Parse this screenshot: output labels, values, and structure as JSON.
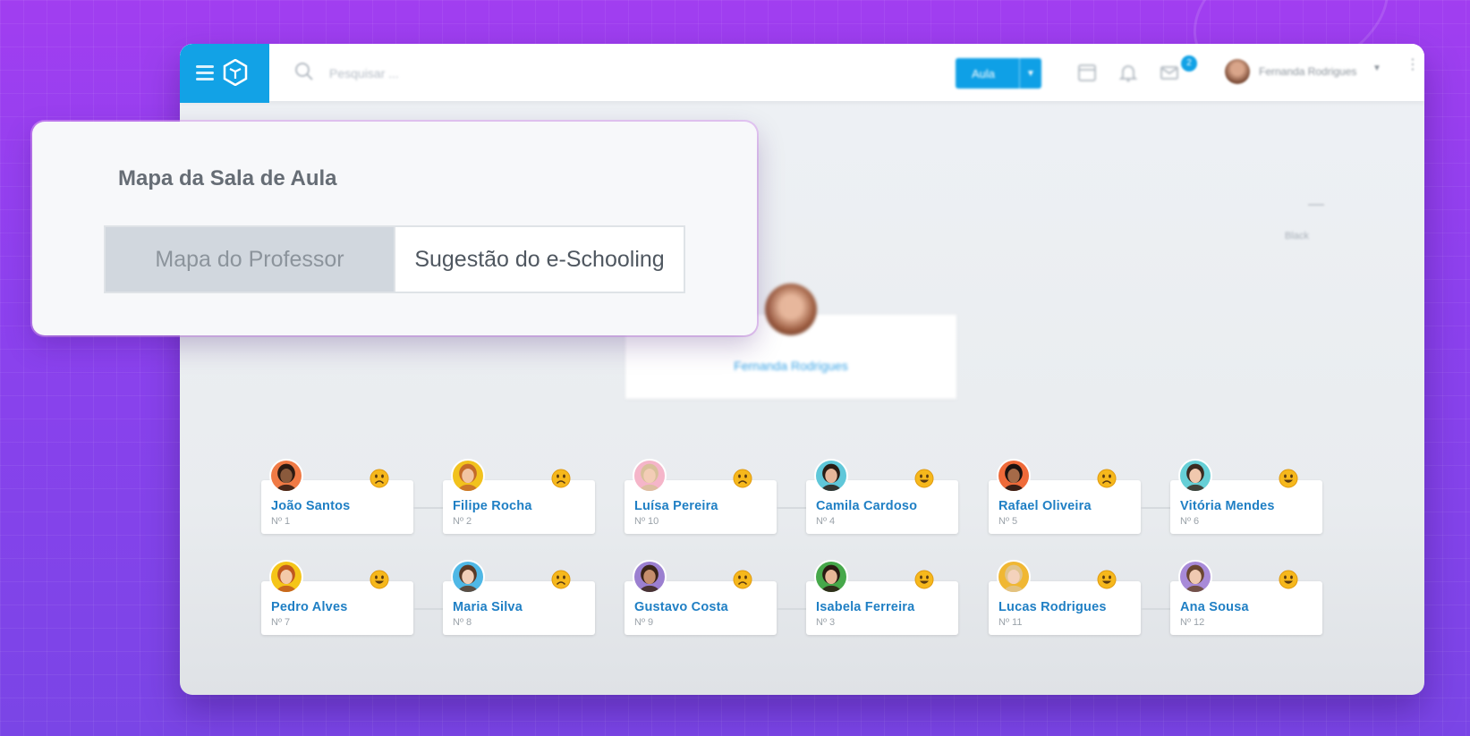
{
  "header": {
    "search_placeholder": "Pesquisar ...",
    "class_button_label": "Aula",
    "messages_badge": "2",
    "user_name": "Fernanda Rodrigues"
  },
  "theme": {
    "dark_mode_label": "Black"
  },
  "teacher": {
    "name": "Fernanda Rodrigues"
  },
  "panel": {
    "title": "Mapa da Sala de Aula",
    "tabs": [
      {
        "label": "Mapa do Professor",
        "active": false
      },
      {
        "label": "Sugestão do e-Schooling",
        "active": true
      }
    ]
  },
  "students": [
    {
      "name": "João Santos",
      "number": "Nº 1",
      "mood": "sad",
      "hair": "#2b1a12",
      "skin": "#8a5a3c",
      "bg": "#f07a45"
    },
    {
      "name": "Filipe Rocha",
      "number": "Nº 2",
      "mood": "sad",
      "hair": "#c46a2a",
      "skin": "#f1c4a2",
      "bg": "#f2c21d"
    },
    {
      "name": "Luísa Pereira",
      "number": "Nº 10",
      "mood": "sad",
      "hair": "#d8c09a",
      "skin": "#f3cdb6",
      "bg": "#f5b5c9"
    },
    {
      "name": "Camila Cardoso",
      "number": "Nº 4",
      "mood": "happy",
      "hair": "#2a1c14",
      "skin": "#e6b69a",
      "bg": "#5fc7d9"
    },
    {
      "name": "Rafael Oliveira",
      "number": "Nº 5",
      "mood": "sad",
      "hair": "#1a1210",
      "skin": "#a56a48",
      "bg": "#ef6a39"
    },
    {
      "name": "Vitória Mendes",
      "number": "Nº 6",
      "mood": "happy",
      "hair": "#3b2a20",
      "skin": "#f0c8ae",
      "bg": "#66cfd6"
    },
    {
      "name": "Pedro Alves",
      "number": "Nº 7",
      "mood": "happy",
      "hair": "#c0571f",
      "skin": "#f3c9a9",
      "bg": "#f5c518"
    },
    {
      "name": "Maria Silva",
      "number": "Nº 8",
      "mood": "sad",
      "hair": "#5b3a26",
      "skin": "#f2cfb8",
      "bg": "#4fb8e6"
    },
    {
      "name": "Gustavo Costa",
      "number": "Nº 9",
      "mood": "sad",
      "hair": "#3a2418",
      "skin": "#c58e6c",
      "bg": "#9b7fd0"
    },
    {
      "name": "Isabela Ferreira",
      "number": "Nº 3",
      "mood": "happy",
      "hair": "#2a1a12",
      "skin": "#e8b797",
      "bg": "#46a84a"
    },
    {
      "name": "Lucas Rodrigues",
      "number": "Nº 11",
      "mood": "happy",
      "hair": "#e0c48e",
      "skin": "#f4d2bc",
      "bg": "#f0b733"
    },
    {
      "name": "Ana Sousa",
      "number": "Nº 12",
      "mood": "happy",
      "hair": "#6a4630",
      "skin": "#f0c9b1",
      "bg": "#a88ad8"
    }
  ],
  "colors": {
    "brand_blue": "#12a2e6",
    "name_blue": "#1f7fc4",
    "mood_yellow": "#f6b81c"
  }
}
